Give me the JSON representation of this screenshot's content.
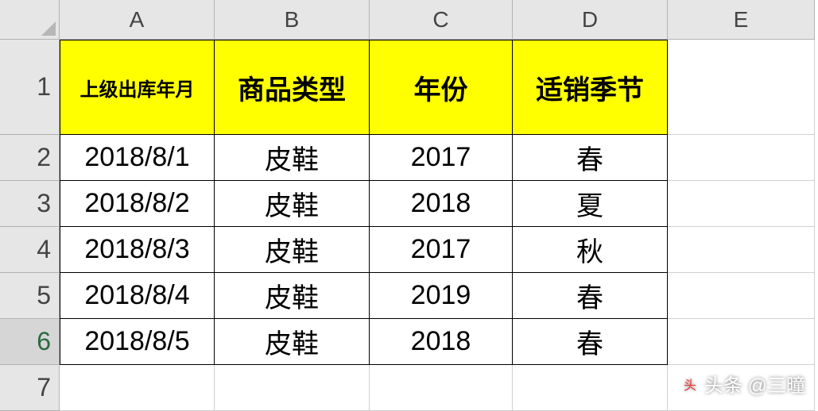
{
  "columns": [
    "A",
    "B",
    "C",
    "D",
    "E"
  ],
  "rows": [
    "1",
    "2",
    "3",
    "4",
    "5",
    "6",
    "7"
  ],
  "headers": {
    "A": "上级出库年月",
    "B": "商品类型",
    "C": "年份",
    "D": "适销季节"
  },
  "data": [
    {
      "A": "2018/8/1",
      "B": "皮鞋",
      "C": "2017",
      "D": "春"
    },
    {
      "A": "2018/8/2",
      "B": "皮鞋",
      "C": "2018",
      "D": "夏"
    },
    {
      "A": "2018/8/3",
      "B": "皮鞋",
      "C": "2017",
      "D": "秋"
    },
    {
      "A": "2018/8/4",
      "B": "皮鞋",
      "C": "2019",
      "D": "春"
    },
    {
      "A": "2018/8/5",
      "B": "皮鞋",
      "C": "2018",
      "D": "春"
    }
  ],
  "watermark": "头条 @三曈"
}
